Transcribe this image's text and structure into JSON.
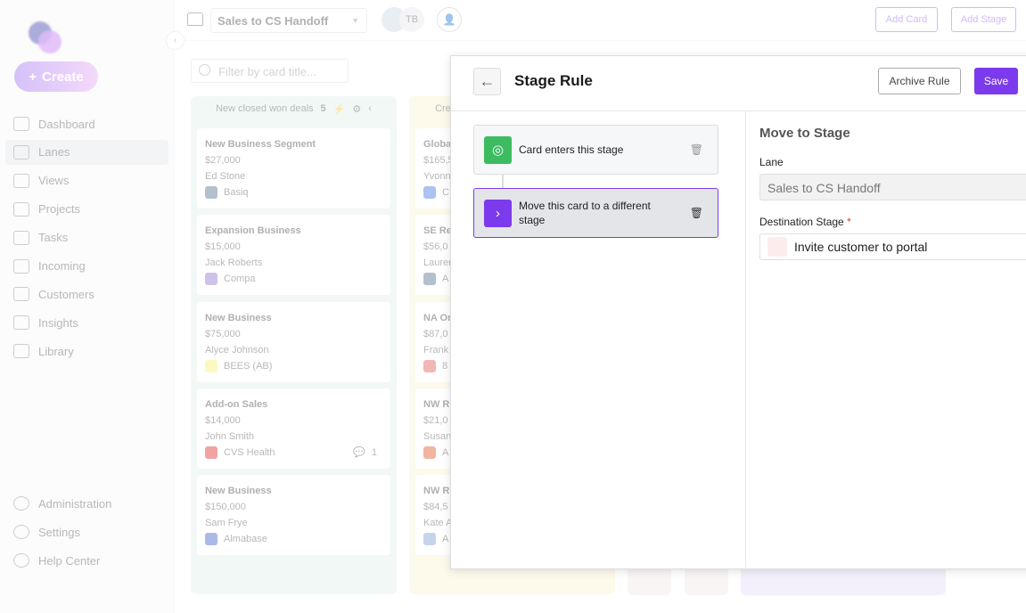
{
  "sidebar": {
    "create_label": "Create",
    "items": [
      {
        "label": "Dashboard",
        "active": false
      },
      {
        "label": "Lanes",
        "active": true
      },
      {
        "label": "Views",
        "active": false
      },
      {
        "label": "Projects",
        "active": false
      },
      {
        "label": "Tasks",
        "active": false
      },
      {
        "label": "Incoming",
        "active": false
      },
      {
        "label": "Customers",
        "active": false
      },
      {
        "label": "Insights",
        "active": false
      },
      {
        "label": "Library",
        "active": false
      }
    ],
    "bottom_items": [
      {
        "label": "Administration"
      },
      {
        "label": "Settings"
      },
      {
        "label": "Help Center"
      }
    ]
  },
  "topbar": {
    "lane_select": "Sales to CS Handoff",
    "avatar_initials": "TB",
    "add_card": "Add Card",
    "add_stage": "Add Stage"
  },
  "filter": {
    "placeholder": "Filter by card title..."
  },
  "lanes": [
    {
      "title": "New closed won deals",
      "count": "5",
      "cards": [
        {
          "title": "New Business Segment",
          "amount": "$27,000",
          "owner": "Ed Stone",
          "company": "Basiq",
          "logo_color": "#4a6a8a"
        },
        {
          "title": "Expansion Business",
          "amount": "$15,000",
          "owner": "Jack Roberts",
          "company": "Compa",
          "logo_color": "#8a6fd0"
        },
        {
          "title": "New Business",
          "amount": "$75,000",
          "owner": "Alyce Johnson",
          "company": "BEES (AB)",
          "logo_color": "#f5f06a"
        },
        {
          "title": "Add-on Sales",
          "amount": "$14,000",
          "owner": "John Smith",
          "company": "CVS Health",
          "logo_color": "#d22",
          "comments": "1"
        },
        {
          "title": "New Business",
          "amount": "$150,000",
          "owner": "Sam Frye",
          "company": "Almabase",
          "logo_color": "#3558c8"
        }
      ]
    },
    {
      "title": "Cre",
      "cards": [
        {
          "title": "Globa",
          "amount": "$165,5",
          "owner": "Yvonn",
          "company": "C",
          "logo_color": "#3b6fe0"
        },
        {
          "title": "SE Re",
          "amount": "$56,0",
          "owner": "Lauren",
          "company": "A",
          "logo_color": "#4a6a8a"
        },
        {
          "title": "NA Or",
          "amount": "$87,0",
          "owner": "Frank",
          "company": "8",
          "logo_color": "#d55"
        },
        {
          "title": "NW R",
          "amount": "$21,0",
          "owner": "Susan",
          "company": "A",
          "logo_color": "#e05020"
        },
        {
          "title": "NW R",
          "amount": "$84,5",
          "owner": "Kate A",
          "company": "A",
          "logo_color": "#7799cc"
        }
      ]
    }
  ],
  "modal": {
    "title": "Stage Rule",
    "archive_label": "Archive Rule",
    "save_label": "Save",
    "steps": [
      {
        "label": "Card enters this stage",
        "icon": "target-icon",
        "color": "#3dbb61"
      },
      {
        "label": "Move this card to a different stage",
        "icon": "chevron-right-icon",
        "color": "#7c3aed",
        "selected": true
      }
    ],
    "panel": {
      "title": "Move to Stage",
      "lane_label": "Lane",
      "lane_value": "Sales to CS Handoff",
      "dest_label": "Destination Stage",
      "required_mark": "*",
      "dest_value": "Invite customer to portal"
    }
  },
  "colors": {
    "accent": "#7c3aed",
    "trigger": "#3dbb61"
  }
}
